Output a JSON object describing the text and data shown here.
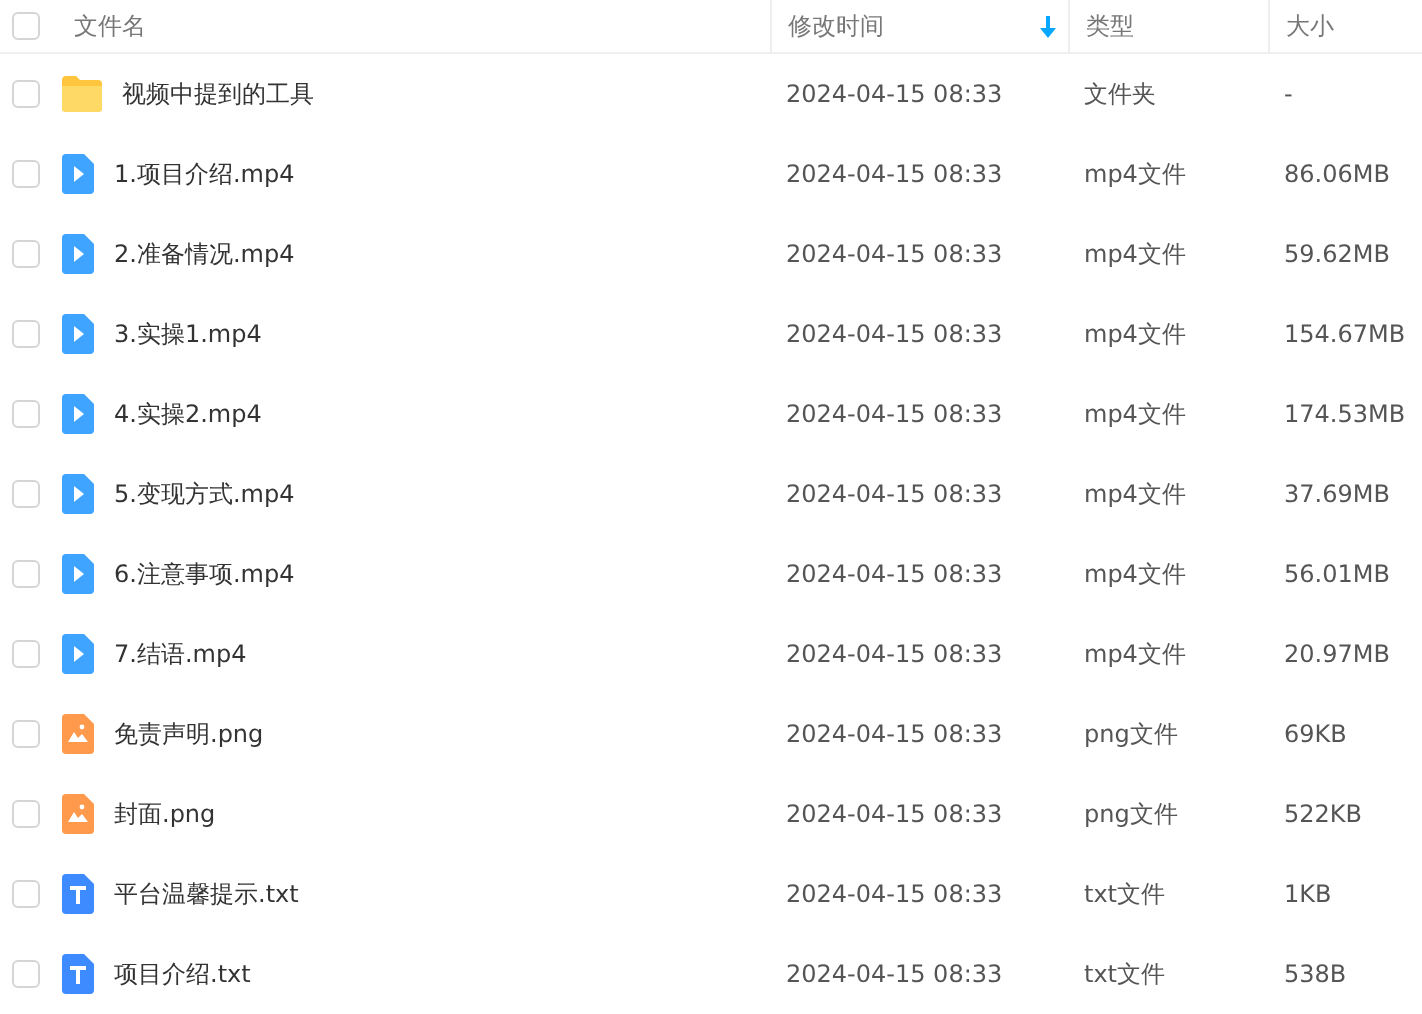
{
  "header": {
    "checked": false,
    "columns": [
      {
        "label": "文件名",
        "sorted": false
      },
      {
        "label": "修改时间",
        "sorted": true
      },
      {
        "label": "类型",
        "sorted": false
      },
      {
        "label": "大小",
        "sorted": false
      }
    ]
  },
  "rows": [
    {
      "kind": "folder",
      "checked": false,
      "name": "视频中提到的工具",
      "time": "2024-04-15 08:33",
      "type": "文件夹",
      "size": "-"
    },
    {
      "kind": "video",
      "checked": false,
      "name": "1.项目介绍.mp4",
      "time": "2024-04-15 08:33",
      "type": "mp4文件",
      "size": "86.06MB"
    },
    {
      "kind": "video",
      "checked": false,
      "name": "2.准备情况.mp4",
      "time": "2024-04-15 08:33",
      "type": "mp4文件",
      "size": "59.62MB"
    },
    {
      "kind": "video",
      "checked": false,
      "name": "3.实操1.mp4",
      "time": "2024-04-15 08:33",
      "type": "mp4文件",
      "size": "154.67MB"
    },
    {
      "kind": "video",
      "checked": false,
      "name": "4.实操2.mp4",
      "time": "2024-04-15 08:33",
      "type": "mp4文件",
      "size": "174.53MB"
    },
    {
      "kind": "video",
      "checked": false,
      "name": "5.变现方式.mp4",
      "time": "2024-04-15 08:33",
      "type": "mp4文件",
      "size": "37.69MB"
    },
    {
      "kind": "video",
      "checked": false,
      "name": "6.注意事项.mp4",
      "time": "2024-04-15 08:33",
      "type": "mp4文件",
      "size": "56.01MB"
    },
    {
      "kind": "video",
      "checked": false,
      "name": "7.结语.mp4",
      "time": "2024-04-15 08:33",
      "type": "mp4文件",
      "size": "20.97MB"
    },
    {
      "kind": "image",
      "checked": false,
      "name": "免责声明.png",
      "time": "2024-04-15 08:33",
      "type": "png文件",
      "size": "69KB"
    },
    {
      "kind": "image",
      "checked": false,
      "name": "封面.png",
      "time": "2024-04-15 08:33",
      "type": "png文件",
      "size": "522KB"
    },
    {
      "kind": "text",
      "checked": false,
      "name": "平台温馨提示.txt",
      "time": "2024-04-15 08:33",
      "type": "txt文件",
      "size": "1KB"
    },
    {
      "kind": "text",
      "checked": false,
      "name": "项目介绍.txt",
      "time": "2024-04-15 08:33",
      "type": "txt文件",
      "size": "538B"
    }
  ]
}
